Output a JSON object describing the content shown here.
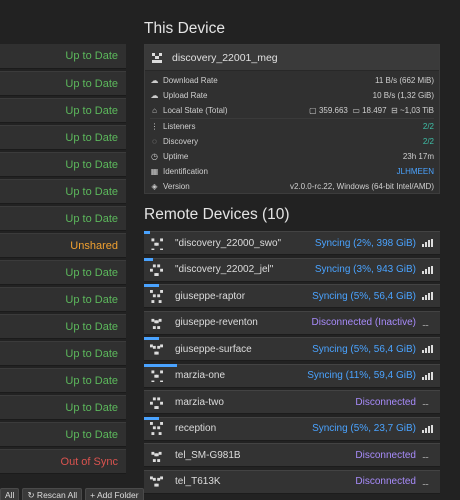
{
  "folders": [
    {
      "status": "Up to Date",
      "kind": "ok"
    },
    {
      "status": "Up to Date",
      "kind": "ok"
    },
    {
      "status": "Up to Date",
      "kind": "ok"
    },
    {
      "status": "Up to Date",
      "kind": "ok"
    },
    {
      "status": "Up to Date",
      "kind": "ok"
    },
    {
      "status": "Up to Date",
      "kind": "ok"
    },
    {
      "status": "Up to Date",
      "kind": "ok"
    },
    {
      "status": "Unshared",
      "kind": "unshared"
    },
    {
      "status": "Up to Date",
      "kind": "ok"
    },
    {
      "status": "Up to Date",
      "kind": "ok"
    },
    {
      "status": "Up to Date",
      "kind": "ok"
    },
    {
      "status": "Up to Date",
      "kind": "ok"
    },
    {
      "status": "Up to Date",
      "kind": "ok"
    },
    {
      "status": "Up to Date",
      "kind": "ok"
    },
    {
      "status": "Up to Date",
      "kind": "ok"
    },
    {
      "status": "Out of Sync",
      "kind": "oos"
    }
  ],
  "folder_buttons": {
    "all": "All",
    "rescan_all": "↻ Rescan All",
    "add_folder": "+ Add Folder"
  },
  "this_device": {
    "heading": "This Device",
    "name": "discovery_22001_meg",
    "download_label": "Download Rate",
    "download_value": "11 B/s (662 MiB)",
    "upload_label": "Upload Rate",
    "upload_value": "10 B/s (1,32 GiB)",
    "local_state_label": "Local State (Total)",
    "local_state_files": "359.663",
    "local_state_dirs": "18.497",
    "local_state_size": "~1,03 TiB",
    "listeners_label": "Listeners",
    "listeners_value": "2/2",
    "discovery_label": "Discovery",
    "discovery_value": "2/2",
    "uptime_label": "Uptime",
    "uptime_value": "23h 17m",
    "identification_label": "Identification",
    "identification_value": "JLHMEEN",
    "version_label": "Version",
    "version_value": "v2.0.0-rc.22, Windows (64-bit Intel/AMD)"
  },
  "remote": {
    "heading": "Remote Devices (10)",
    "devices": [
      {
        "name": "\"discovery_22000_swo\"",
        "status": "Syncing (2%, 398 GiB)",
        "kind": "sync",
        "progress": 0.02
      },
      {
        "name": "\"discovery_22002_jel\"",
        "status": "Syncing (3%, 943 GiB)",
        "kind": "sync",
        "progress": 0.03
      },
      {
        "name": "giuseppe-raptor",
        "status": "Syncing (5%, 56,4 GiB)",
        "kind": "sync",
        "progress": 0.05
      },
      {
        "name": "giuseppe-reventon",
        "status": "Disconnected (Inactive)",
        "kind": "disc",
        "progress": 0
      },
      {
        "name": "giuseppe-surface",
        "status": "Syncing (5%, 56,4 GiB)",
        "kind": "sync",
        "progress": 0.05
      },
      {
        "name": "marzia-one",
        "status": "Syncing (11%, 59,4 GiB)",
        "kind": "sync",
        "progress": 0.11
      },
      {
        "name": "marzia-two",
        "status": "Disconnected",
        "kind": "disc",
        "progress": 0
      },
      {
        "name": "reception",
        "status": "Syncing (5%, 23,7 GiB)",
        "kind": "sync",
        "progress": 0.05
      },
      {
        "name": "tel_SM-G981B",
        "status": "Disconnected",
        "kind": "disc",
        "progress": 0
      },
      {
        "name": "tel_T613K",
        "status": "Disconnected",
        "kind": "disc",
        "progress": 0
      }
    ]
  },
  "colors": {
    "sync": "#4aa3ff",
    "disconnected": "#a78bfa",
    "ok": "#5cb85c",
    "unshared": "#f0a030",
    "out_of_sync": "#d9534f"
  }
}
